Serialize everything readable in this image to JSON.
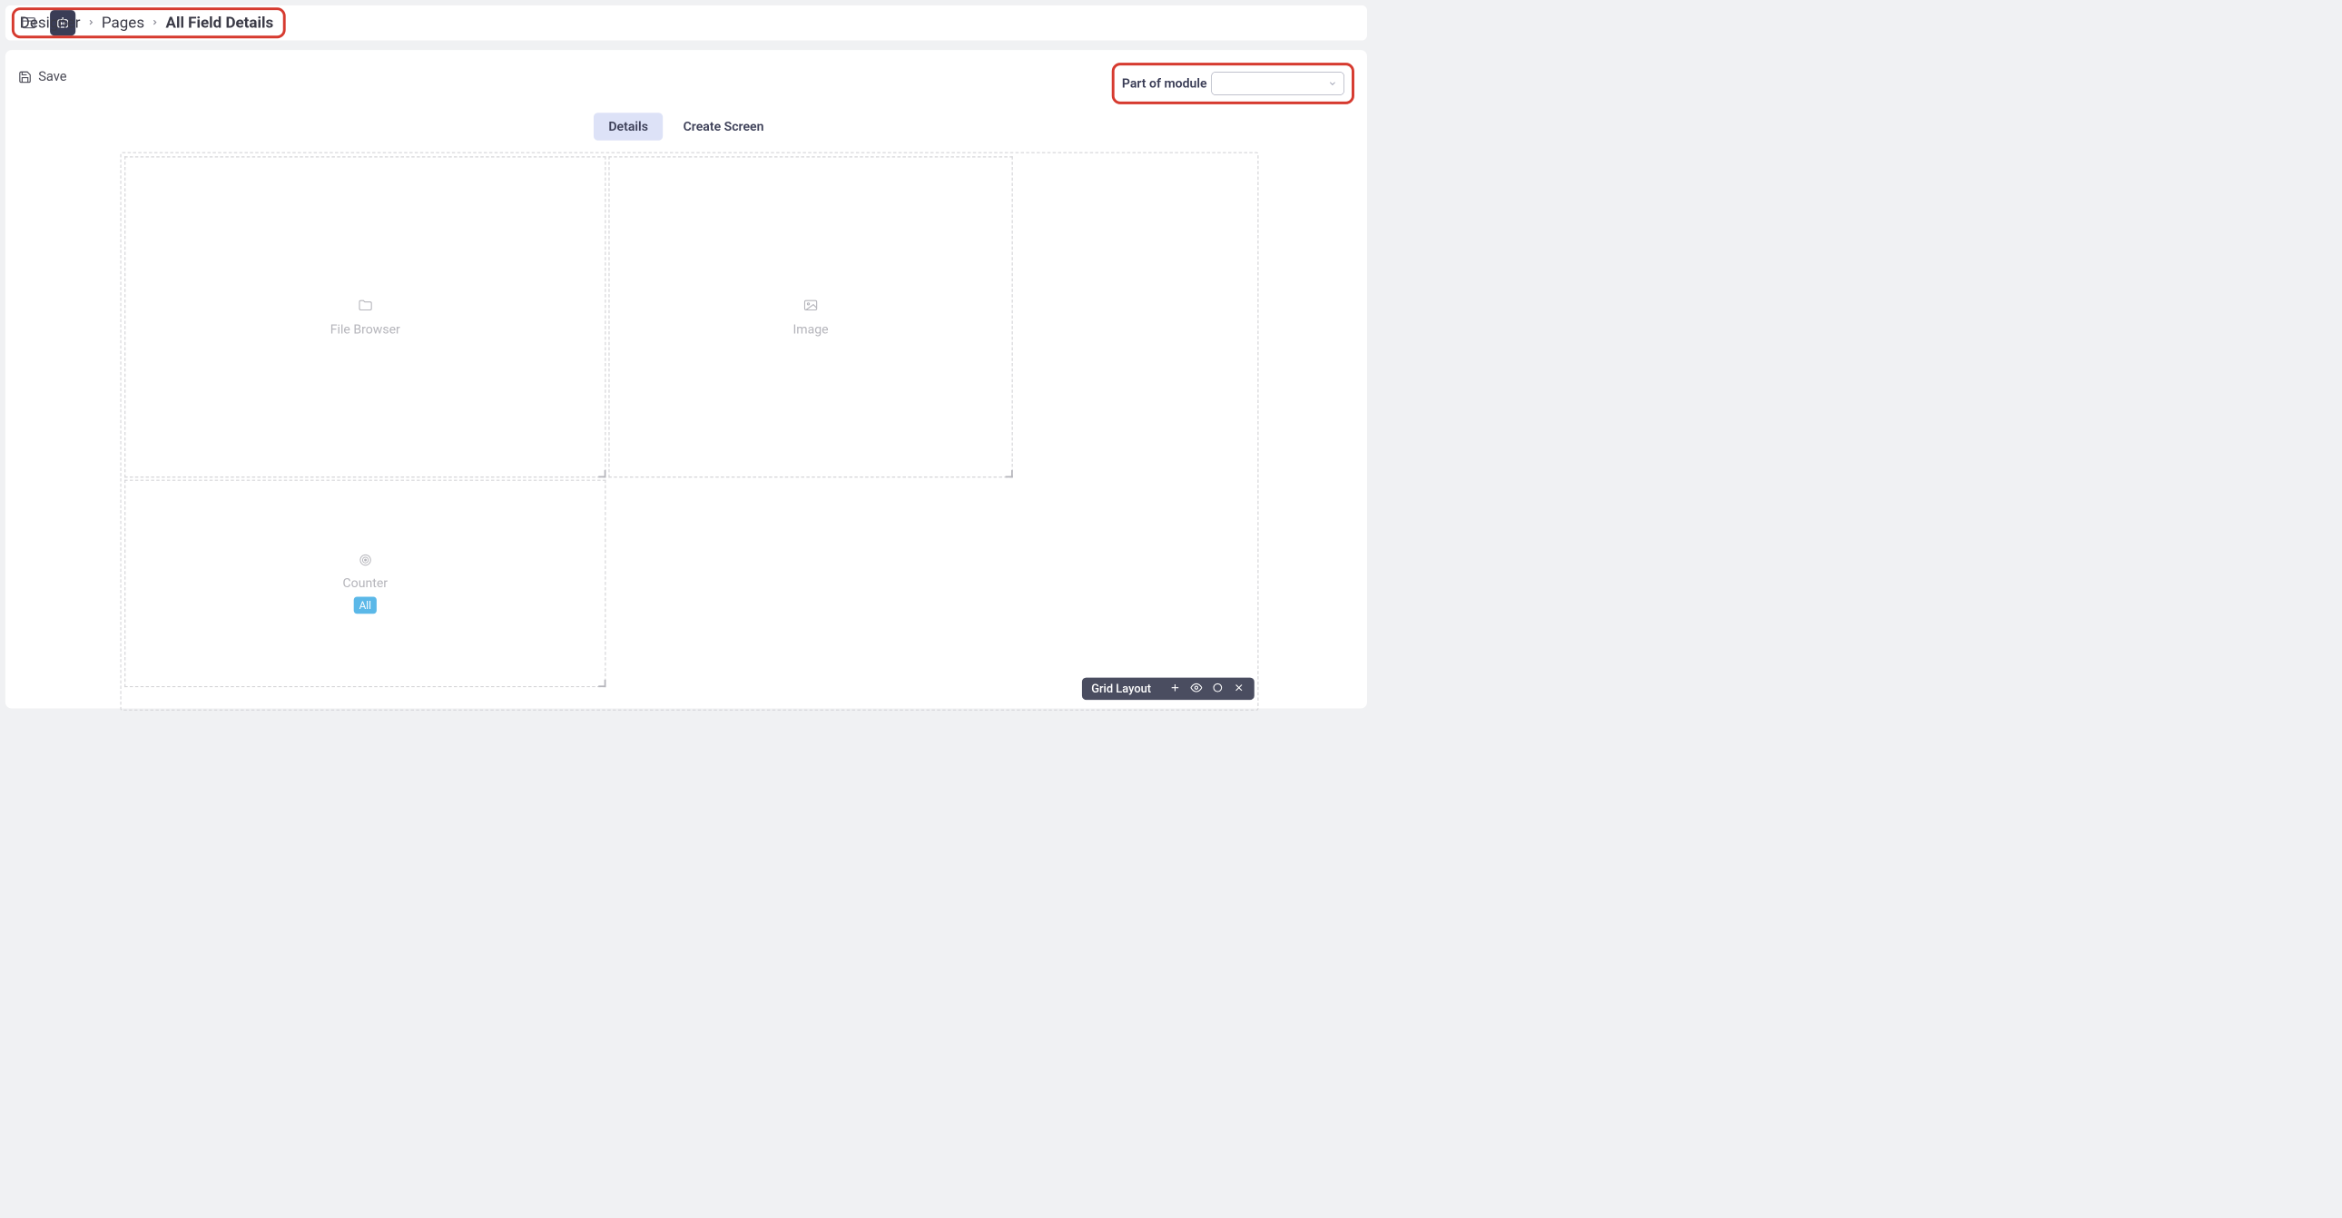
{
  "breadcrumb": {
    "items": [
      "Designer",
      "Pages",
      "All Field Details"
    ],
    "currentIndex": 2
  },
  "toolbar": {
    "save_label": "Save"
  },
  "module": {
    "label": "Part of module",
    "value": ""
  },
  "tabs": {
    "items": [
      "Details",
      "Create Screen"
    ],
    "activeIndex": 0
  },
  "canvas": {
    "widgets": [
      {
        "label": "File Browser",
        "icon": "folder"
      },
      {
        "label": "Image",
        "icon": "image"
      },
      {
        "label": "Counter",
        "icon": "target",
        "tag": "All"
      }
    ]
  },
  "floatingToolbar": {
    "label": "Grid Layout"
  }
}
